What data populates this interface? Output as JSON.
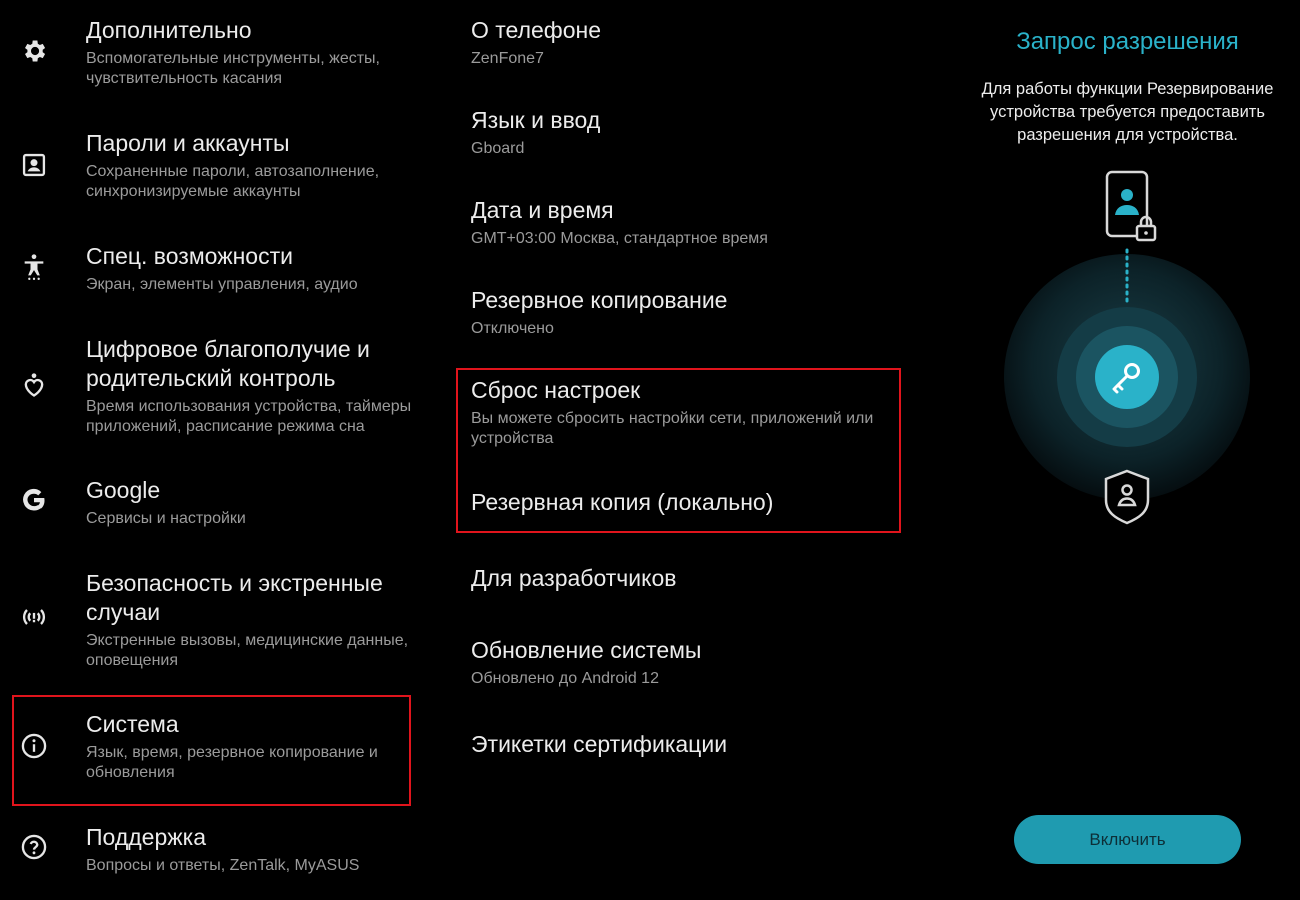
{
  "settings": {
    "items": [
      {
        "icon": "gear-icon",
        "title": "Дополнительно",
        "subtitle": "Вспомогательные инструменты, жесты, чувствительность касания"
      },
      {
        "icon": "account-box-icon",
        "title": "Пароли и аккаунты",
        "subtitle": "Сохраненные пароли, автозаполнение, синхронизируемые аккаунты"
      },
      {
        "icon": "accessibility-icon",
        "title": "Спец. возможности",
        "subtitle": "Экран, элементы управления, аудио"
      },
      {
        "icon": "wellbeing-icon",
        "title": "Цифровое благополучие и родительский контроль",
        "subtitle": "Время использования устройства, таймеры приложений, расписание режима сна"
      },
      {
        "icon": "google-icon",
        "title": "Google",
        "subtitle": "Сервисы и настройки"
      },
      {
        "icon": "emergency-icon",
        "title": "Безопасность и экстренные случаи",
        "subtitle": "Экстренные вызовы, медицинские данные, оповещения"
      },
      {
        "icon": "info-icon",
        "title": "Система",
        "subtitle": "Язык, время, резервное копирование и обновления"
      },
      {
        "icon": "help-icon",
        "title": "Поддержка",
        "subtitle": "Вопросы и ответы, ZenTalk, MyASUS"
      }
    ]
  },
  "system": {
    "items": [
      {
        "title": "О телефоне",
        "subtitle": "ZenFone7"
      },
      {
        "title": "Язык и ввод",
        "subtitle": "Gboard"
      },
      {
        "title": "Дата и время",
        "subtitle": "GMT+03:00 Москва, стандартное время"
      },
      {
        "title": "Резервное копирование",
        "subtitle": "Отключено"
      },
      {
        "title": "Сброс настроек",
        "subtitle": "Вы можете сбросить настройки сети, приложений или устройства"
      },
      {
        "title": "Резервная копия (локально)"
      },
      {
        "title": "Для разработчиков"
      },
      {
        "title": "Обновление системы",
        "subtitle": "Обновлено до Android 12"
      },
      {
        "title": "Этикетки сертификации"
      }
    ]
  },
  "permission": {
    "title": "Запрос разрешения",
    "description": "Для работы функции Резервирование устройства требуется предоставить разрешения для устройства.",
    "enable_button": "Включить"
  },
  "colors": {
    "background": "#000000",
    "accent": "#2ab2c9",
    "highlight": "#e0141c",
    "button": "#1f9bb0"
  }
}
